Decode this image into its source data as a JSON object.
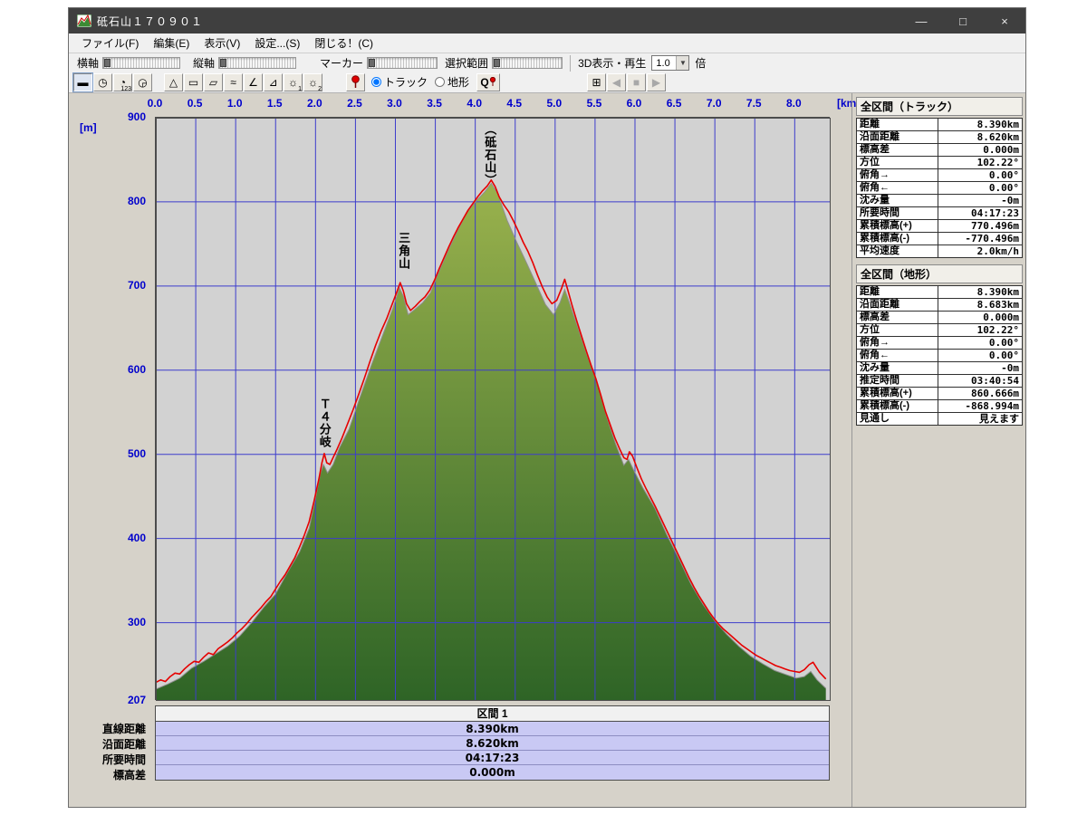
{
  "window": {
    "title": "砥石山１７０９０１",
    "controls": [
      {
        "name": "minimize-button",
        "glyph": "—"
      },
      {
        "name": "maximize-button",
        "glyph": "□"
      },
      {
        "name": "close-button",
        "glyph": "×"
      }
    ]
  },
  "menu": {
    "items": [
      {
        "name": "menu-file",
        "label": "ファイル(F)"
      },
      {
        "name": "menu-edit",
        "label": "編集(E)"
      },
      {
        "name": "menu-view",
        "label": "表示(V)"
      },
      {
        "name": "menu-settings",
        "label": "設定...(S)"
      },
      {
        "name": "menu-close",
        "label": "閉じる！(C)"
      }
    ]
  },
  "toolbar": {
    "haxis_label": "横軸",
    "vaxis_label": "縦軸",
    "marker_label": "マーカー",
    "selection_label": "選択範囲",
    "playback_label": "3D表示・再生",
    "speed_value": "1.0",
    "speed_suffix": "倍",
    "marker_radio_track": "トラック",
    "marker_radio_terrain": "地形",
    "marker_target": "track",
    "xmode_buttons": [
      {
        "name": "xaxis-distance-button",
        "glyph": "▬",
        "selected": true
      },
      {
        "name": "xaxis-elapsed-time-button",
        "glyph": "◷"
      },
      {
        "name": "xaxis-clock-time-button",
        "glyph": "◔",
        "sub": "123"
      },
      {
        "name": "xaxis-pace-button",
        "glyph": "◶"
      }
    ],
    "graph_buttons": [
      {
        "name": "graph-area-button",
        "glyph": "△"
      },
      {
        "name": "graph-line-button",
        "glyph": "▭"
      },
      {
        "name": "graph-band-button",
        "glyph": "▱"
      },
      {
        "name": "graph-speed-button",
        "glyph": "≈"
      },
      {
        "name": "graph-slope-button",
        "glyph": "∠"
      },
      {
        "name": "graph-angle-button",
        "glyph": "⊿"
      },
      {
        "name": "graph-option1-button",
        "glyph": "☼",
        "sub": "1"
      },
      {
        "name": "graph-option2-button",
        "glyph": "☼",
        "sub": "2"
      }
    ],
    "playback_buttons": [
      {
        "name": "playback-position-button",
        "glyph": "⊞",
        "disabled": false
      },
      {
        "name": "playback-rewind-button",
        "glyph": "◀",
        "disabled": true
      },
      {
        "name": "playback-stop-button",
        "glyph": "■",
        "disabled": true
      },
      {
        "name": "playback-play-button",
        "glyph": "▶",
        "disabled": true
      }
    ]
  },
  "chart": {
    "unit_y": "[m]",
    "unit_x": "[km]",
    "x_ticks": [
      0,
      0.5,
      1,
      1.5,
      2,
      2.5,
      3,
      3.5,
      4,
      4.5,
      5,
      5.5,
      6,
      6.5,
      7,
      7.5,
      8
    ],
    "y_ticks": [
      900,
      800,
      700,
      600,
      500,
      400,
      300
    ],
    "y_min_label": "207",
    "colors": {
      "grid": "#3d3dcc",
      "track": "#e60000",
      "terrain_line": "#8f8f8f",
      "fill_top": "#a8bc52",
      "fill_bottom": "#2e6426",
      "plot_bg": "#d2d2d2",
      "label_blue": "#0000cc"
    }
  },
  "chart_data": {
    "type": "area",
    "xlabel": "[km]",
    "ylabel": "[m]",
    "xlim": [
      0,
      8.45
    ],
    "ylim": [
      207,
      900
    ],
    "annotations": [
      {
        "label": "（砥石山）",
        "x": 4.2,
        "top": 893
      },
      {
        "label": "三角山",
        "x": 3.12,
        "top": 763
      },
      {
        "label": "Ｔ４分岐",
        "x": 2.13,
        "top": 566
      }
    ],
    "series": [
      {
        "name": "トラック",
        "points": [
          [
            0,
            229
          ],
          [
            0.06,
            232
          ],
          [
            0.12,
            230
          ],
          [
            0.18,
            236
          ],
          [
            0.24,
            240
          ],
          [
            0.3,
            239
          ],
          [
            0.36,
            245
          ],
          [
            0.42,
            250
          ],
          [
            0.48,
            254
          ],
          [
            0.54,
            253
          ],
          [
            0.6,
            259
          ],
          [
            0.66,
            264
          ],
          [
            0.72,
            262
          ],
          [
            0.78,
            269
          ],
          [
            0.84,
            273
          ],
          [
            0.9,
            277
          ],
          [
            0.96,
            282
          ],
          [
            1.02,
            288
          ],
          [
            1.08,
            293
          ],
          [
            1.14,
            299
          ],
          [
            1.2,
            306
          ],
          [
            1.26,
            312
          ],
          [
            1.32,
            318
          ],
          [
            1.38,
            325
          ],
          [
            1.44,
            331
          ],
          [
            1.5,
            340
          ],
          [
            1.56,
            349
          ],
          [
            1.62,
            357
          ],
          [
            1.68,
            367
          ],
          [
            1.74,
            377
          ],
          [
            1.8,
            390
          ],
          [
            1.86,
            404
          ],
          [
            1.92,
            420
          ],
          [
            1.98,
            444
          ],
          [
            2.04,
            470
          ],
          [
            2.08,
            490
          ],
          [
            2.11,
            501
          ],
          [
            2.14,
            490
          ],
          [
            2.18,
            488
          ],
          [
            2.22,
            496
          ],
          [
            2.27,
            506
          ],
          [
            2.33,
            519
          ],
          [
            2.4,
            536
          ],
          [
            2.47,
            553
          ],
          [
            2.54,
            571
          ],
          [
            2.61,
            590
          ],
          [
            2.68,
            610
          ],
          [
            2.75,
            629
          ],
          [
            2.82,
            646
          ],
          [
            2.89,
            661
          ],
          [
            2.95,
            676
          ],
          [
            3.01,
            691
          ],
          [
            3.06,
            704
          ],
          [
            3.1,
            694
          ],
          [
            3.14,
            679
          ],
          [
            3.19,
            671
          ],
          [
            3.25,
            676
          ],
          [
            3.31,
            682
          ],
          [
            3.37,
            687
          ],
          [
            3.43,
            695
          ],
          [
            3.49,
            707
          ],
          [
            3.55,
            721
          ],
          [
            3.61,
            734
          ],
          [
            3.67,
            747
          ],
          [
            3.73,
            759
          ],
          [
            3.79,
            770
          ],
          [
            3.85,
            780
          ],
          [
            3.91,
            790
          ],
          [
            3.97,
            798
          ],
          [
            4.03,
            806
          ],
          [
            4.09,
            813
          ],
          [
            4.15,
            819
          ],
          [
            4.2,
            826
          ],
          [
            4.25,
            818
          ],
          [
            4.3,
            806
          ],
          [
            4.36,
            796
          ],
          [
            4.42,
            788
          ],
          [
            4.48,
            777
          ],
          [
            4.54,
            765
          ],
          [
            4.6,
            752
          ],
          [
            4.66,
            741
          ],
          [
            4.72,
            728
          ],
          [
            4.78,
            713
          ],
          [
            4.84,
            699
          ],
          [
            4.9,
            687
          ],
          [
            4.96,
            679
          ],
          [
            5.02,
            683
          ],
          [
            5.08,
            697
          ],
          [
            5.12,
            708
          ],
          [
            5.16,
            695
          ],
          [
            5.21,
            678
          ],
          [
            5.27,
            659
          ],
          [
            5.33,
            641
          ],
          [
            5.39,
            623
          ],
          [
            5.45,
            606
          ],
          [
            5.51,
            590
          ],
          [
            5.57,
            571
          ],
          [
            5.63,
            551
          ],
          [
            5.69,
            535
          ],
          [
            5.75,
            519
          ],
          [
            5.81,
            506
          ],
          [
            5.86,
            496
          ],
          [
            5.9,
            494
          ],
          [
            5.93,
            503
          ],
          [
            5.97,
            498
          ],
          [
            6.02,
            485
          ],
          [
            6.08,
            471
          ],
          [
            6.14,
            459
          ],
          [
            6.2,
            448
          ],
          [
            6.26,
            437
          ],
          [
            6.32,
            425
          ],
          [
            6.38,
            413
          ],
          [
            6.44,
            401
          ],
          [
            6.5,
            389
          ],
          [
            6.56,
            377
          ],
          [
            6.62,
            365
          ],
          [
            6.68,
            353
          ],
          [
            6.74,
            342
          ],
          [
            6.8,
            332
          ],
          [
            6.86,
            323
          ],
          [
            6.92,
            314
          ],
          [
            6.98,
            306
          ],
          [
            7.04,
            299
          ],
          [
            7.1,
            293
          ],
          [
            7.16,
            288
          ],
          [
            7.22,
            283
          ],
          [
            7.28,
            278
          ],
          [
            7.34,
            273
          ],
          [
            7.4,
            269
          ],
          [
            7.46,
            265
          ],
          [
            7.52,
            261
          ],
          [
            7.58,
            258
          ],
          [
            7.64,
            255
          ],
          [
            7.7,
            252
          ],
          [
            7.76,
            249
          ],
          [
            7.82,
            247
          ],
          [
            7.88,
            245
          ],
          [
            7.94,
            243
          ],
          [
            8,
            242
          ],
          [
            8.06,
            241
          ],
          [
            8.12,
            244
          ],
          [
            8.18,
            250
          ],
          [
            8.23,
            253
          ],
          [
            8.27,
            247
          ],
          [
            8.31,
            241
          ],
          [
            8.35,
            237
          ],
          [
            8.39,
            233
          ]
        ]
      },
      {
        "name": "地形",
        "points": [
          [
            0,
            221
          ],
          [
            0.15,
            227
          ],
          [
            0.3,
            234
          ],
          [
            0.45,
            246
          ],
          [
            0.6,
            254
          ],
          [
            0.75,
            263
          ],
          [
            0.9,
            272
          ],
          [
            1.05,
            284
          ],
          [
            1.2,
            300
          ],
          [
            1.35,
            318
          ],
          [
            1.5,
            334
          ],
          [
            1.65,
            360
          ],
          [
            1.8,
            384
          ],
          [
            1.92,
            412
          ],
          [
            2,
            448
          ],
          [
            2.06,
            477
          ],
          [
            2.1,
            488
          ],
          [
            2.15,
            478
          ],
          [
            2.22,
            488
          ],
          [
            2.3,
            508
          ],
          [
            2.42,
            530
          ],
          [
            2.55,
            566
          ],
          [
            2.7,
            606
          ],
          [
            2.85,
            644
          ],
          [
            2.97,
            674
          ],
          [
            3.05,
            698
          ],
          [
            3.1,
            688
          ],
          [
            3.16,
            666
          ],
          [
            3.24,
            672
          ],
          [
            3.34,
            680
          ],
          [
            3.44,
            692
          ],
          [
            3.54,
            716
          ],
          [
            3.66,
            742
          ],
          [
            3.78,
            766
          ],
          [
            3.9,
            788
          ],
          [
            4.02,
            802
          ],
          [
            4.12,
            812
          ],
          [
            4.2,
            822
          ],
          [
            4.28,
            810
          ],
          [
            4.4,
            778
          ],
          [
            4.52,
            752
          ],
          [
            4.64,
            728
          ],
          [
            4.76,
            703
          ],
          [
            4.88,
            678
          ],
          [
            4.98,
            666
          ],
          [
            5.06,
            680
          ],
          [
            5.12,
            696
          ],
          [
            5.18,
            680
          ],
          [
            5.28,
            652
          ],
          [
            5.4,
            618
          ],
          [
            5.52,
            586
          ],
          [
            5.64,
            546
          ],
          [
            5.76,
            512
          ],
          [
            5.86,
            487
          ],
          [
            5.92,
            494
          ],
          [
            5.98,
            482
          ],
          [
            6.1,
            460
          ],
          [
            6.25,
            436
          ],
          [
            6.4,
            404
          ],
          [
            6.55,
            376
          ],
          [
            6.7,
            346
          ],
          [
            6.85,
            322
          ],
          [
            7,
            302
          ],
          [
            7.15,
            286
          ],
          [
            7.3,
            272
          ],
          [
            7.45,
            260
          ],
          [
            7.6,
            251
          ],
          [
            7.75,
            243
          ],
          [
            7.9,
            238
          ],
          [
            8.02,
            234
          ],
          [
            8.12,
            236
          ],
          [
            8.2,
            242
          ],
          [
            8.28,
            232
          ],
          [
            8.39,
            222
          ]
        ]
      }
    ]
  },
  "section": {
    "header": "区間 1",
    "rows": [
      {
        "label": "直線距離",
        "value": "8.390km"
      },
      {
        "label": "沿面距離",
        "value": "8.620km"
      },
      {
        "label": "所要時間",
        "value": "04:17:23"
      },
      {
        "label": "標高差",
        "value": "0.000m"
      }
    ]
  },
  "right_panel": {
    "track": {
      "title": "全区間（トラック）",
      "rows": [
        [
          "距離",
          "8.390km"
        ],
        [
          "沿面距離",
          "8.620km"
        ],
        [
          "標高差",
          "0.000m"
        ],
        [
          "方位",
          "102.22°"
        ],
        [
          "俯角→",
          "0.00°"
        ],
        [
          "俯角←",
          "0.00°"
        ],
        [
          "沈み量",
          "-0m"
        ],
        [
          "所要時間",
          "04:17:23"
        ],
        [
          "累積標高(+)",
          "770.496m"
        ],
        [
          "累積標高(-)",
          "-770.496m"
        ],
        [
          "平均速度",
          "2.0km/h"
        ]
      ]
    },
    "terrain": {
      "title": "全区間（地形）",
      "rows": [
        [
          "距離",
          "8.390km"
        ],
        [
          "沿面距離",
          "8.683km"
        ],
        [
          "標高差",
          "0.000m"
        ],
        [
          "方位",
          "102.22°"
        ],
        [
          "俯角→",
          "0.00°"
        ],
        [
          "俯角←",
          "0.00°"
        ],
        [
          "沈み量",
          "-0m"
        ],
        [
          "推定時間",
          "03:40:54"
        ],
        [
          "累積標高(+)",
          "860.666m"
        ],
        [
          "累積標高(-)",
          "-868.994m"
        ],
        [
          "見通し",
          "見えます"
        ]
      ]
    }
  }
}
